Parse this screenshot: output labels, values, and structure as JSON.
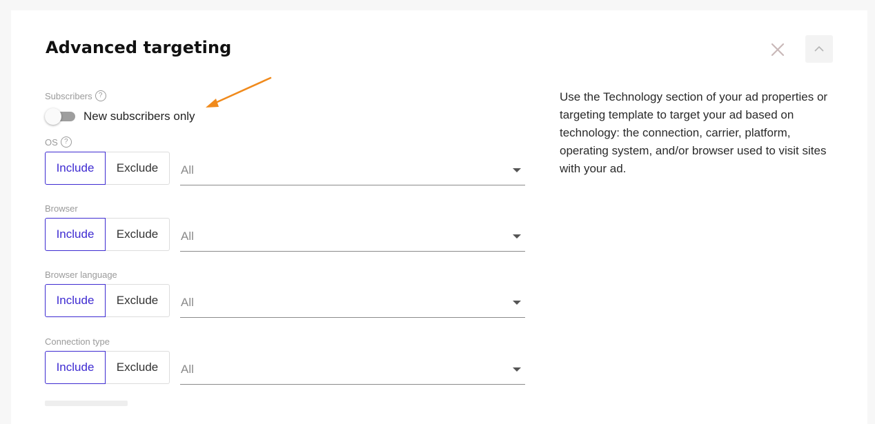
{
  "header": {
    "title": "Advanced targeting",
    "close_icon": "close-icon",
    "collapse_icon": "chevron-up-icon"
  },
  "subscribers": {
    "label": "Subscribers",
    "help_glyph": "?",
    "toggle_label": "New subscribers only",
    "toggle_on": false
  },
  "filters": [
    {
      "label": "OS",
      "include": "Include",
      "exclude": "Exclude",
      "selected": "Include",
      "value": "All",
      "has_help": true
    },
    {
      "label": "Browser",
      "include": "Include",
      "exclude": "Exclude",
      "selected": "Include",
      "value": "All",
      "has_help": false
    },
    {
      "label": "Browser language",
      "include": "Include",
      "exclude": "Exclude",
      "selected": "Include",
      "value": "All",
      "has_help": false
    },
    {
      "label": "Connection type",
      "include": "Include",
      "exclude": "Exclude",
      "selected": "Include",
      "value": "All",
      "has_help": false
    }
  ],
  "info_text": "Use the Technology section of your ad properties or targeting template to target your ad based on technology: the connection, carrier, platform, operating system, and/or browser used to visit sites with your ad.",
  "colors": {
    "accent": "#3d2ad1",
    "annotation_arrow": "#f08a1c",
    "toggle_track": "#9e9e9e"
  }
}
